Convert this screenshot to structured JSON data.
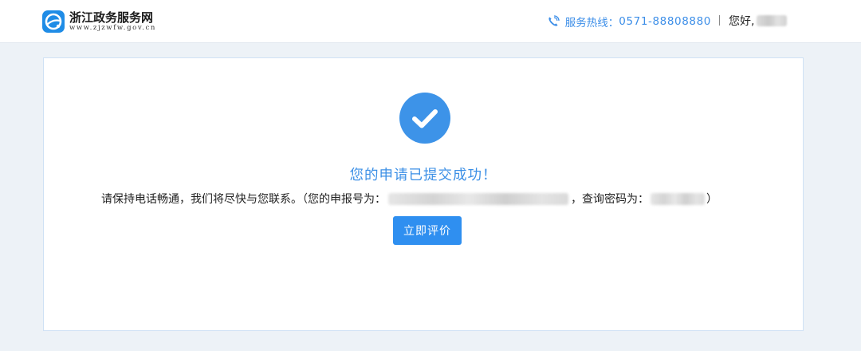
{
  "header": {
    "logo_name": "浙江政务服务网",
    "logo_url": "www.zjzwfw.gov.cn",
    "hotline_label": "服务热线：",
    "hotline_number": "0571-88808880",
    "greeting": "您好,",
    "icons": {
      "logo": "zjzwfw-logo-icon",
      "phone": "phone-icon"
    }
  },
  "main": {
    "success_icon": "check-circle-icon",
    "title": "您的申请已提交成功！",
    "info_prefix": "请保持电话畅通，我们将尽快与您联系。（您的申报号为：",
    "info_password_label": "，查询密码为：",
    "info_suffix": "）",
    "rate_button": "立即评价"
  },
  "colors": {
    "accent": "#3c8ee8",
    "button": "#2f8ff0",
    "background": "#edf2f7"
  }
}
